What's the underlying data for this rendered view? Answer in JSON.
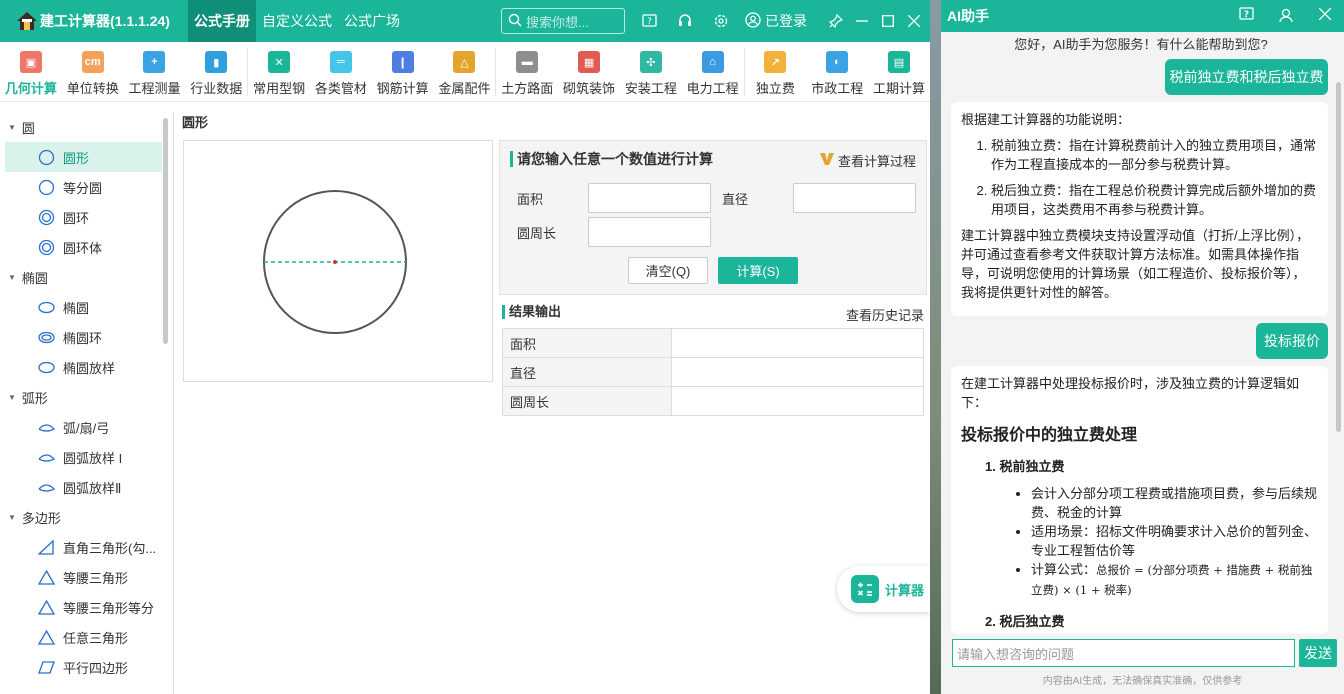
{
  "app": {
    "title": "建工计算器(1.1.1.24)",
    "menu": [
      "公式手册",
      "自定义公式",
      "公式广场"
    ],
    "search_placeholder": "搜索你想...",
    "login": "已登录"
  },
  "toolbar": [
    {
      "label": "几何计算",
      "color": "#f0766a",
      "glyph": "▣"
    },
    {
      "label": "单位转换",
      "color": "#f2a25b",
      "glyph": "cm"
    },
    {
      "label": "工程测量",
      "color": "#3aa3e3",
      "glyph": "+"
    },
    {
      "label": "行业数据",
      "color": "#2f9fe0",
      "glyph": "▮"
    },
    {
      "label": "常用型钢",
      "color": "#1bb59a",
      "glyph": "✕"
    },
    {
      "label": "各类管材",
      "color": "#45c6e8",
      "glyph": "═"
    },
    {
      "label": "钢筋计算",
      "color": "#4f7de0",
      "glyph": "❙"
    },
    {
      "label": "金属配件",
      "color": "#e5a52c",
      "glyph": "△"
    },
    {
      "label": "土方路面",
      "color": "#8e8e8e",
      "glyph": "▬"
    },
    {
      "label": "砌筑装饰",
      "color": "#e05b52",
      "glyph": "▦"
    },
    {
      "label": "安装工程",
      "color": "#2fb8a4",
      "glyph": "✣"
    },
    {
      "label": "电力工程",
      "color": "#3a9be0",
      "glyph": "⌂"
    },
    {
      "label": "独立费",
      "color": "#f2b23a",
      "glyph": "↗"
    },
    {
      "label": "市政工程",
      "color": "#3aa3e3",
      "glyph": "◐"
    },
    {
      "label": "工期计算",
      "color": "#1bb59a",
      "glyph": "▤"
    }
  ],
  "sidebar": {
    "groups": [
      {
        "label": "圆",
        "items": [
          "圆形",
          "等分圆",
          "圆环",
          "圆环体"
        ]
      },
      {
        "label": "椭圆",
        "items": [
          "椭圆",
          "椭圆环",
          "椭圆放样"
        ]
      },
      {
        "label": "弧形",
        "items": [
          "弧/扇/弓",
          "圆弧放样 I",
          "圆弧放样Ⅱ"
        ]
      },
      {
        "label": "多边形",
        "items": [
          "直角三角形(勾...",
          "等腰三角形",
          "等腰三角形等分",
          "任意三角形",
          "平行四边形"
        ]
      }
    ]
  },
  "content": {
    "title": "圆形",
    "input_title": "请您输入任意一个数值进行计算",
    "view_process": "查看计算过程",
    "fields": {
      "area": "面积",
      "diameter": "直径",
      "circumference": "圆周长"
    },
    "clear": "清空(Q)",
    "calc": "计算(S)",
    "result_title": "结果输出",
    "history": "查看历史记录",
    "results": [
      {
        "label": "面积",
        "value": ""
      },
      {
        "label": "直径",
        "value": ""
      },
      {
        "label": "圆周长",
        "value": ""
      }
    ],
    "float_label": "计算器"
  },
  "ai": {
    "title": "AI助手",
    "greeting": "您好，AI助手为您服务！有什么能帮助到您?",
    "q1": "税前独立费和税后独立费",
    "a1": {
      "intro": "根据建工计算器的功能说明：",
      "items": [
        "税前独立费：指在计算税费前计入的独立费用项目，通常作为工程直接成本的一部分参与税费计算。",
        "税后独立费：指在工程总价税费计算完成后额外增加的费用项目，这类费用不再参与税费计算。"
      ],
      "outro": "建工计算器中独立费模块支持设置浮动值（打折/上浮比例），并可通过查看参考文件获取计算方法标准。如需具体操作指导，可说明您使用的计算场景（如工程造价、投标报价等），我将提供更针对性的解答。"
    },
    "q2": "投标报价",
    "a2": {
      "intro": "在建工计算器中处理投标报价时，涉及独立费的计算逻辑如下：",
      "heading": "投标报价中的独立费处理",
      "sub1": "1. 税前独立费",
      "bullets": [
        "会计入分部分项工程费或措施项目费，参与后续规费、税金的计算",
        "适用场景：招标文件明确要求计入总价的暂列金、专业工程暂估价等"
      ],
      "formula_label": "计算公式：",
      "formula": "总报价 = (分部分项费 + 措施费 + 税前独立费) × (1 + 税率)",
      "sub2": "2. 税后独立费"
    },
    "input_placeholder": "请输入想咨询的问题",
    "send": "发送",
    "disclaimer": "内容由AI生成，无法确保真实准确，仅供参考"
  }
}
